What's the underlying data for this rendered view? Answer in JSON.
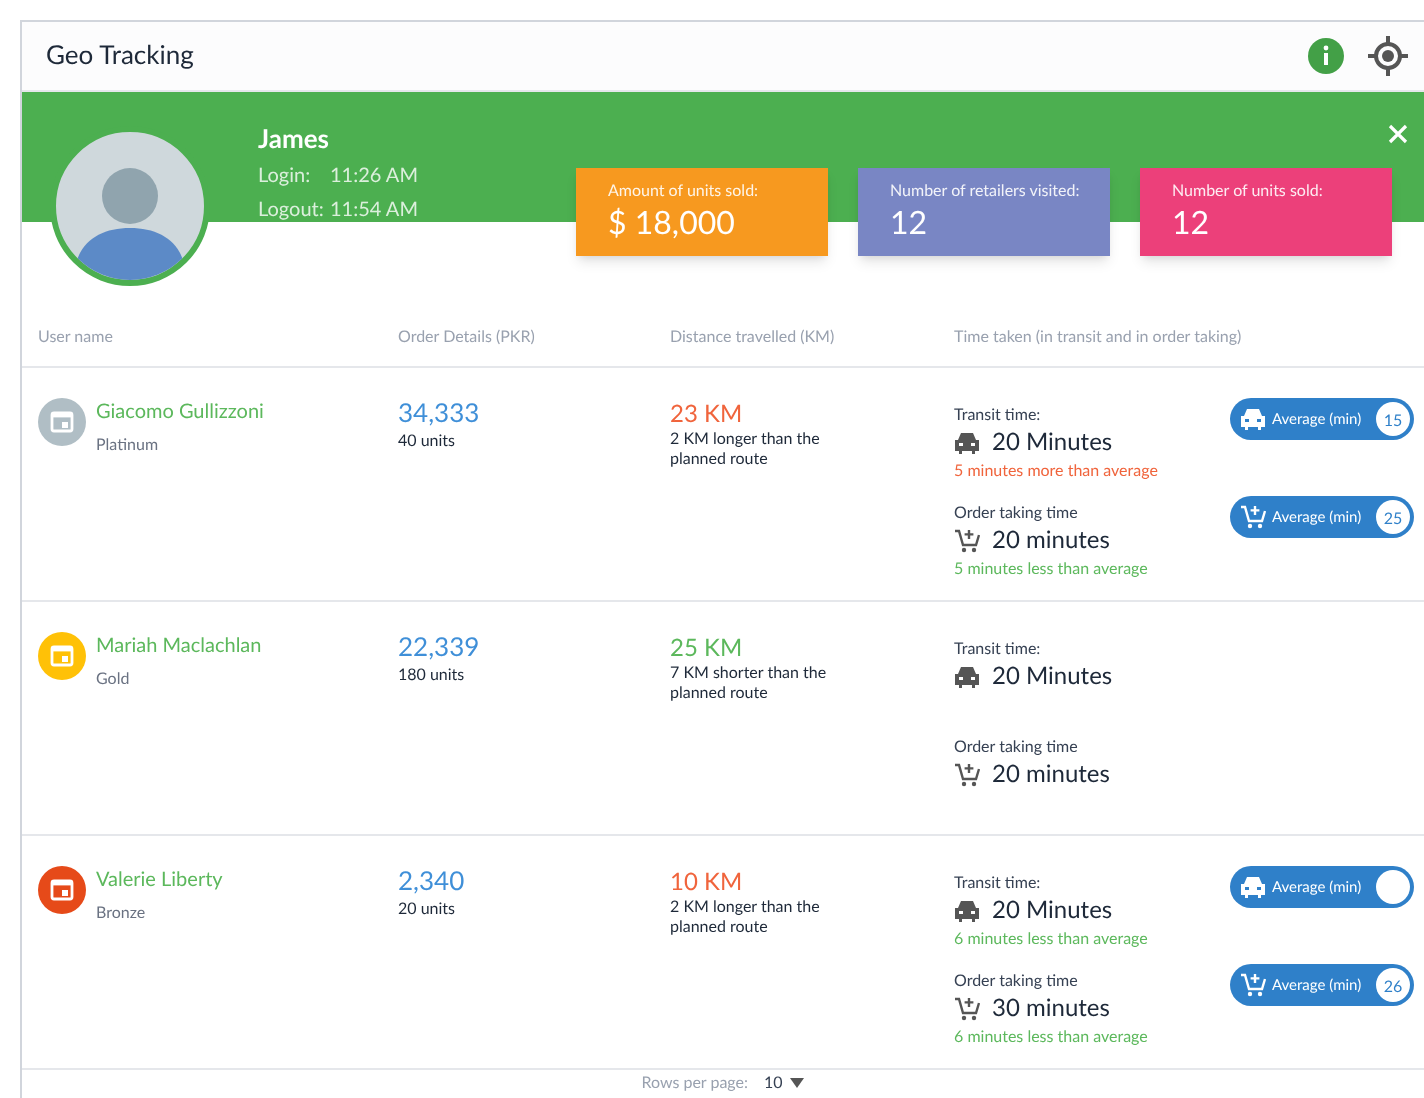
{
  "header": {
    "title": "Geo Tracking"
  },
  "profile": {
    "name": "James",
    "login_label": "Login:",
    "login_time": "11:26 AM",
    "logout_label": "Logout:",
    "logout_time": "11:54 AM"
  },
  "stats": [
    {
      "label": "Amount of units sold:",
      "value": "$ 18,000",
      "color": "#f7991f"
    },
    {
      "label": "Number of retailers visited:",
      "value": "12",
      "color": "#7986c4"
    },
    {
      "label": "Number of units sold:",
      "value": "12",
      "color": "#ec407a"
    }
  ],
  "columns": [
    "User name",
    "Order Details (PKR)",
    "Distance travelled (KM)",
    "Time taken (in transit and in order taking)"
  ],
  "rows": [
    {
      "name": "Giacomo Gullizzoni",
      "tier": "Platinum",
      "color": "#b0bec5",
      "amount": "34,333",
      "units": "40 units",
      "distance": {
        "value": "23 KM",
        "color": "#f0643c",
        "note": "2 KM longer than the planned route"
      },
      "transit": {
        "label": "Transit time:",
        "value": "20 Minutes",
        "note": "5 minutes more than average",
        "color": "#f0643c",
        "badge": {
          "label": "Average (min)",
          "count": "15"
        }
      },
      "order": {
        "label": "Order taking time",
        "value": "20 minutes",
        "note": "5 minutes less than average",
        "color": "#5cb85c",
        "badge": {
          "label": "Average (min)",
          "count": "25"
        }
      }
    },
    {
      "name": "Mariah  Maclachlan",
      "tier": "Gold",
      "color": "#ffc107",
      "amount": "22,339",
      "units": "180 units",
      "distance": {
        "value": "25 KM",
        "color": "#5cb85c",
        "note": "7 KM shorter than the planned route"
      },
      "transit": {
        "label": "Transit time:",
        "value": "20 Minutes"
      },
      "order": {
        "label": "Order taking time",
        "value": "20 minutes"
      }
    },
    {
      "name": "Valerie Liberty",
      "tier": "Bronze",
      "color": "#e64a19",
      "amount": "2,340",
      "units": "20 units",
      "distance": {
        "value": "10 KM",
        "color": "#f0643c",
        "note": "2 KM longer than the planned route"
      },
      "transit": {
        "label": "Transit time:",
        "value": "20 Minutes",
        "note": "6 minutes less than average",
        "color": "#5cb85c",
        "badge": {
          "label": "Average (min)"
        }
      },
      "order": {
        "label": "Order taking time",
        "value": "30 minutes",
        "note": "6 minutes less than average",
        "color": "#5cb85c",
        "badge": {
          "label": "Average (min)",
          "count": "26"
        }
      }
    }
  ],
  "footer": {
    "label": "Rows per page:",
    "value": "10"
  }
}
